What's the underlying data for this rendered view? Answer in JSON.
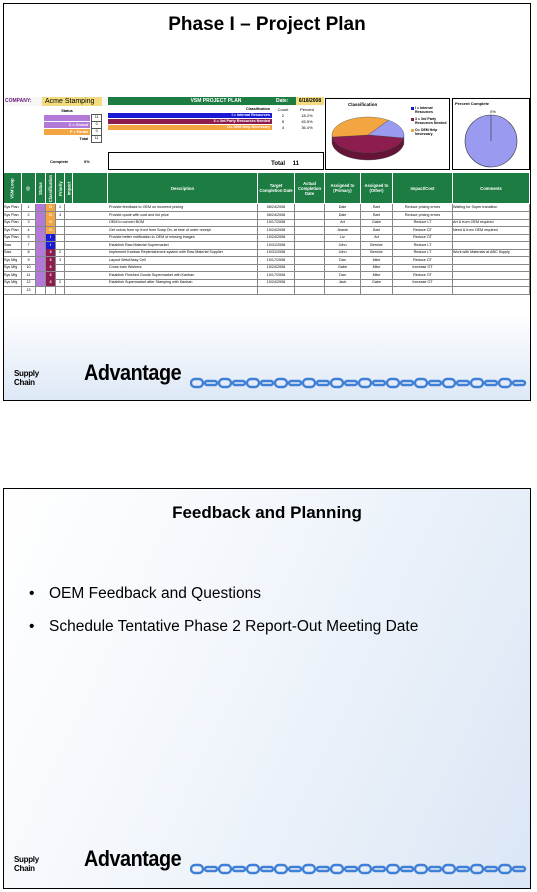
{
  "slide1": {
    "title": "Phase I – Project Plan",
    "company_label": "COMPANY:",
    "company_name": "Acme Stamping",
    "header": "VSM PROJECT PLAN",
    "date_label": "Date:",
    "date_value": "6/18/2008",
    "status_title": "Status",
    "status_rows": [
      {
        "label": "",
        "value": "11",
        "color": "#b27ad6"
      },
      {
        "label": "C = Closed",
        "value": "0",
        "color": "#b27ad6"
      },
      {
        "label": "P = Partial",
        "value": "0",
        "color": "#f2a541"
      },
      {
        "label": "Total",
        "value": "11",
        "color": "#ffffff"
      }
    ],
    "classification_header": "Classification",
    "count_header": "Count",
    "percent_header": "Percent",
    "classification_rows": [
      {
        "label": "I = Internal Resources",
        "count": "2",
        "percent": "18.2%",
        "color": "#1a1ad6"
      },
      {
        "label": "3 = 3rd Party Resources Needed",
        "count": "5",
        "percent": "45.5%",
        "color": "#8e1d4f"
      },
      {
        "label": "O= OEM Help Necessary",
        "count": "4",
        "percent": "36.4%",
        "color": "#f2a541"
      }
    ],
    "total_label": "Total",
    "total_value": "11",
    "complete_label": "Complete",
    "complete_value": "0%",
    "chart_data": {
      "type": "pie",
      "title": "Classification",
      "categories": [
        "I = Internal Resources",
        "3 = 3rd Party Resources Needed",
        "O= OEM Help Necessary"
      ],
      "values": [
        18.2,
        45.5,
        36.4
      ],
      "colors": [
        "#9a9af0",
        "#8e1d4f",
        "#f2a541"
      ],
      "legend_position": "right"
    },
    "percent_complete": {
      "title": "Percent Complete",
      "value": "0%",
      "fraction": 0
    },
    "columns": [
      "VSM Loop",
      "ID",
      "Status",
      "Classification",
      "Priority",
      "Impact",
      "Description",
      "Target Completion Date",
      "Actual Completion Date",
      "Assigned to (Primary)",
      "Assigned to (Other)",
      "Impact/Cost",
      "Comments"
    ],
    "rows": [
      {
        "loop": "Sys Plan",
        "id": "1",
        "status": "",
        "cls": "O",
        "pri": "1",
        "desc": "Provide feedback to OEM on incorrect pricing",
        "target": "06/24/2008",
        "actual": "",
        "primary": "Dale",
        "other": "Bart",
        "impact": "Reduce pricing errors",
        "comments": "Waiting for Super transition",
        "sc": "#b27ad6",
        "cc": "#f2a541"
      },
      {
        "loop": "Sys Plan",
        "id": "2",
        "status": "",
        "cls": "O",
        "pri": "4",
        "desc": "Provide quote with cost and list price",
        "target": "06/24/2008",
        "actual": "",
        "primary": "Dale",
        "other": "Bart",
        "impact": "Reduce pricing errors",
        "comments": "",
        "sc": "#b27ad6",
        "cc": "#f2a541"
      },
      {
        "loop": "Sys Plan",
        "id": "3",
        "status": "",
        "cls": "O",
        "pri": "",
        "desc": "OEM to convert BOM",
        "target": "10/17/2008",
        "actual": "",
        "primary": "Art",
        "other": "Gabe",
        "impact": "Reduce LT",
        "comments": "Art & from OEM required",
        "sc": "#b27ad6",
        "cc": "#f2a541"
      },
      {
        "loop": "Sys Plan",
        "id": "4",
        "status": "",
        "cls": "O",
        "pri": "",
        "desc": "Get colors from up front from Snap On, at time of order receipt",
        "target": "10/24/2008",
        "actual": "",
        "primary": "Jeanie",
        "other": "Bart",
        "impact": "Reduce OT",
        "comments": "Need & from OEM required",
        "sc": "#b27ad6",
        "cc": "#f2a541"
      },
      {
        "loop": "Sys Plan",
        "id": "5",
        "status": "",
        "cls": "I",
        "pri": "",
        "desc": "Provide better notification to OEM of missing images",
        "target": "10/24/2008",
        "actual": "",
        "primary": "Liz",
        "other": "Art",
        "impact": "Reduce OT",
        "comments": "",
        "sc": "#b27ad6",
        "cc": "#1a1ad6"
      },
      {
        "loop": "Saw",
        "id": "7",
        "status": "",
        "cls": "I",
        "pri": "",
        "desc": "Establish Raw Material Supermarket",
        "target": "10/31/2008",
        "actual": "",
        "primary": "John",
        "other": "Bernice",
        "impact": "Reduce LT",
        "comments": "",
        "sc": "#b27ad6",
        "cc": "#1a1ad6"
      },
      {
        "loop": "Saw",
        "id": "8",
        "status": "",
        "cls": "3",
        "pri": "2",
        "desc": "Implement Kanban Replenishment system with Raw Material Supplier",
        "target": "10/31/2008",
        "actual": "",
        "primary": "John",
        "other": "Bernice",
        "impact": "Reduce LT",
        "comments": "Work with Materials at ABC Supply",
        "sc": "#b27ad6",
        "cc": "#8e1d4f"
      },
      {
        "loop": "Sys Mfg",
        "id": "9",
        "status": "",
        "cls": "3",
        "pri": "3",
        "desc": "Layout Weld/Assy Cell",
        "target": "10/17/2008",
        "actual": "",
        "primary": "Dan",
        "other": "Mike",
        "impact": "Reduce OT",
        "comments": "",
        "sc": "#b27ad6",
        "cc": "#8e1d4f"
      },
      {
        "loop": "Sys Mfg",
        "id": "10",
        "status": "",
        "cls": "3",
        "pri": "",
        "desc": "Cross train Workers",
        "target": "10/24/2008",
        "actual": "",
        "primary": "Gabe",
        "other": "Mike",
        "impact": "Increase OT",
        "comments": "",
        "sc": "#b27ad6",
        "cc": "#8e1d4f"
      },
      {
        "loop": "Sys Mfg",
        "id": "11",
        "status": "",
        "cls": "3",
        "pri": "",
        "desc": "Establish Finished Goods Supermarket with Kanban",
        "target": "10/17/2008",
        "actual": "",
        "primary": "Dan",
        "other": "Mike",
        "impact": "Reduce OT",
        "comments": "",
        "sc": "#b27ad6",
        "cc": "#8e1d4f"
      },
      {
        "loop": "Sys Mfg",
        "id": "12",
        "status": "",
        "cls": "3",
        "pri": "2",
        "desc": "Establish Supermarket after Stamping with Kanban",
        "target": "10/24/2008",
        "actual": "",
        "primary": "Jack",
        "other": "Gabe",
        "impact": "Increase OT",
        "comments": "",
        "sc": "#b27ad6",
        "cc": "#8e1d4f"
      },
      {
        "loop": "",
        "id": "13",
        "status": "",
        "cls": "",
        "pri": "",
        "desc": "",
        "target": "",
        "actual": "",
        "primary": "",
        "other": "",
        "impact": "",
        "comments": "",
        "sc": "#ffffff",
        "cc": "#ffffff"
      }
    ]
  },
  "slide2": {
    "title": "Feedback and Planning",
    "bullets": [
      "OEM Feedback and Questions",
      "Schedule Tentative Phase 2 Report-Out Meeting Date"
    ]
  },
  "logo": {
    "prefix": "Supply Chain",
    "brand": "Advantage",
    "chain_color": "#3f7fd6"
  }
}
